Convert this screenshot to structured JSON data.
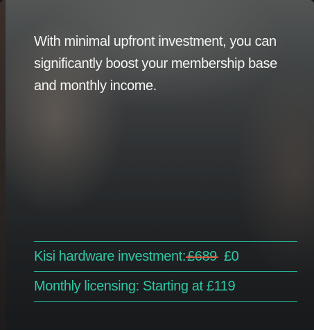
{
  "intro": {
    "text": "With minimal upfront investment, you can significantly boost your membership base and monthly income."
  },
  "pricing": {
    "hardware": {
      "label": "Kisi hardware investment:",
      "old_price": "£689",
      "new_price": "£0"
    },
    "licensing": {
      "label": "Monthly licensing: Starting at £119"
    }
  },
  "colors": {
    "accent": "#2fc7a6",
    "strikethrough": "#e0533a",
    "text": "#f4f4f2"
  }
}
